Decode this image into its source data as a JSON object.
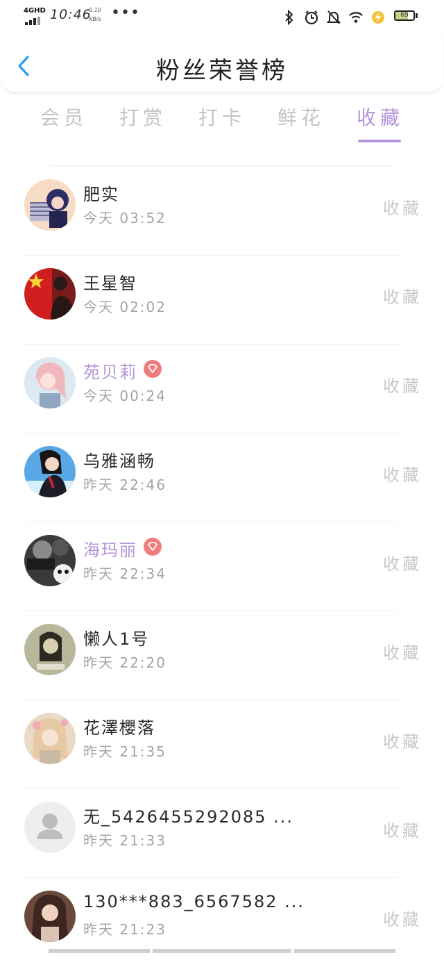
{
  "status_bar": {
    "network": "4GHD",
    "time": "10:46",
    "speed_value": "0.10",
    "speed_unit": "KB/s",
    "more": "•••",
    "battery": "69"
  },
  "header": {
    "title": "粉丝荣誉榜",
    "back_icon": "chevron-left-icon"
  },
  "tabs": [
    {
      "label": "会员"
    },
    {
      "label": "打赏"
    },
    {
      "label": "打卡"
    },
    {
      "label": "鲜花"
    },
    {
      "label": "收藏",
      "active": true
    }
  ],
  "colors": {
    "accent": "#b694d9",
    "back_arrow": "#2a9df4",
    "vip_badge": "#f07d7d",
    "muted": "#a5a5a5"
  },
  "fans": [
    {
      "name": "肥实",
      "time": "今天 03:52",
      "action": "收藏",
      "vip": false
    },
    {
      "name": "王星智",
      "time": "今天 02:02",
      "action": "收藏",
      "vip": false
    },
    {
      "name": "苑贝莉",
      "time": "今天 00:24",
      "action": "收藏",
      "vip": true
    },
    {
      "name": "乌雅涵畅",
      "time": "昨天 22:46",
      "action": "收藏",
      "vip": false
    },
    {
      "name": "海玛丽",
      "time": "昨天 22:34",
      "action": "收藏",
      "vip": true
    },
    {
      "name": "懒人1号",
      "time": "昨天 22:20",
      "action": "收藏",
      "vip": false
    },
    {
      "name": "花澤櫻落",
      "time": "昨天 21:35",
      "action": "收藏",
      "vip": false
    },
    {
      "name": "无_5426455292085 ...",
      "time": "昨天 21:33",
      "action": "收藏",
      "vip": false
    },
    {
      "name": "130***883_6567582 ...",
      "time": "昨天 21:23",
      "action": "收藏",
      "vip": false
    }
  ]
}
